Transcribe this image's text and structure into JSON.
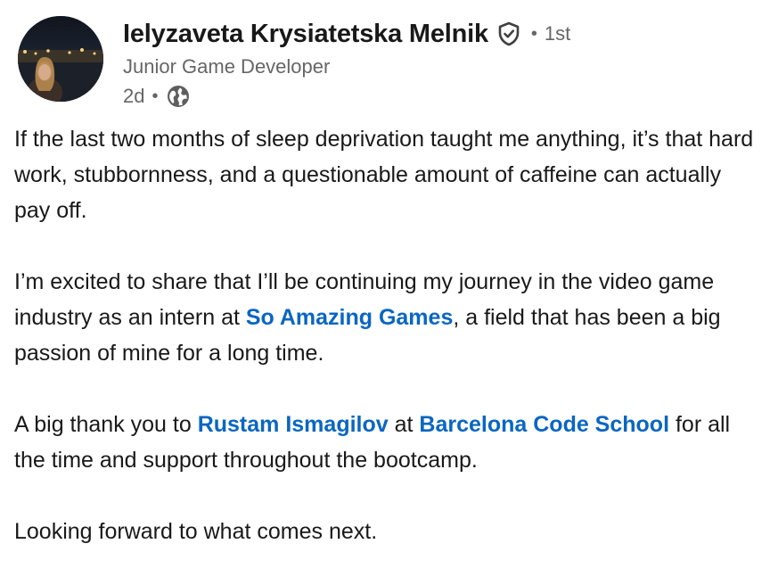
{
  "author": {
    "name": "Ielyzaveta Krysiatetska Melnik",
    "connection_degree": "1st",
    "separator": "•",
    "headline": "Junior Game Developer",
    "post_time": "2d",
    "meta_separator": "•",
    "verified_icon": "verified-shield-icon",
    "visibility_icon": "globe-icon"
  },
  "post": {
    "paragraph1": "If the last two months of sleep deprivation taught me anything, it’s that hard work, stubbornness, and a questionable amount of caffeine can actually pay off.",
    "paragraph2": {
      "before": "I’m excited to share that I’ll be continuing my journey in the video game industry as an intern at ",
      "mention": "So Amazing Games",
      "after": ", a field that has been a big passion of mine for a long time."
    },
    "paragraph3": {
      "before": "A big thank you to ",
      "mention1": "Rustam Ismagilov",
      "middle": " at ",
      "mention2": "Barcelona Code School",
      "after": " for all the time and support throughout the bootcamp."
    },
    "paragraph4": "Looking forward to what comes next."
  },
  "colors": {
    "link": "#0a66c2",
    "text": "#191919",
    "secondary": "#666666"
  }
}
